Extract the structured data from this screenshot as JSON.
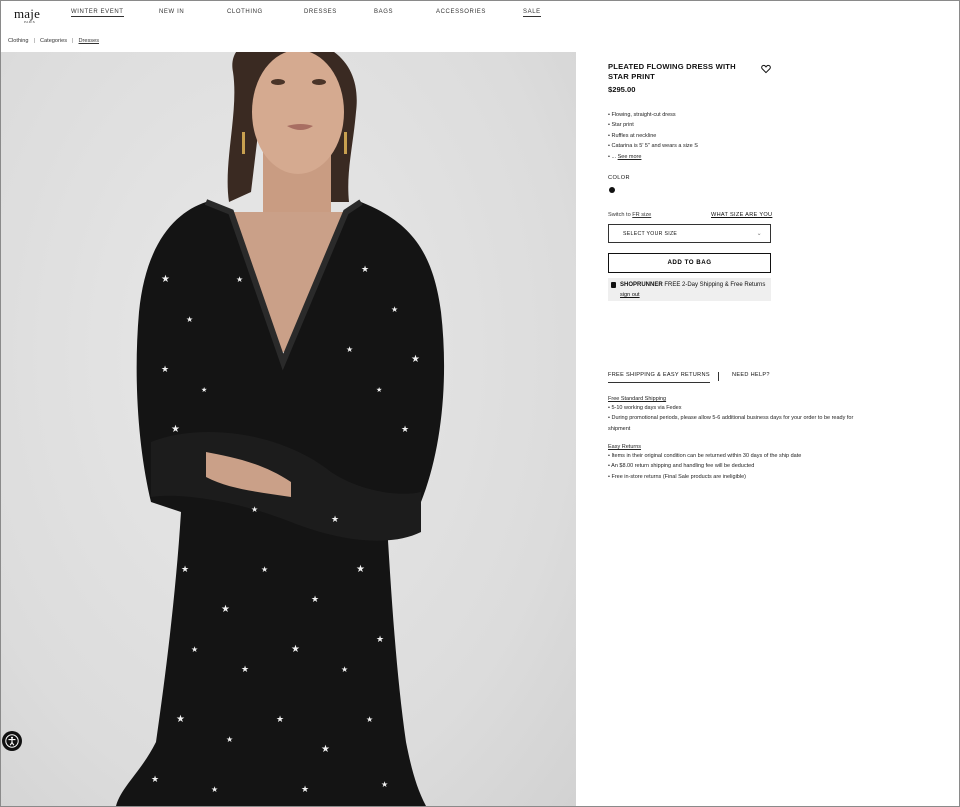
{
  "brand": {
    "logo": "maje",
    "logo_sub": "PARIS"
  },
  "nav": [
    {
      "label": "WINTER EVENT"
    },
    {
      "label": "NEW IN"
    },
    {
      "label": "CLOTHING"
    },
    {
      "label": "DRESSES"
    },
    {
      "label": "BAGS"
    },
    {
      "label": "ACCESSORIES"
    },
    {
      "label": "SALE"
    }
  ],
  "breadcrumb": {
    "items": [
      "Clothing",
      "Categories",
      "Dresses"
    ],
    "separator": "|"
  },
  "product": {
    "name": "PLEATED FLOWING DRESS WITH STAR PRINT",
    "price": "$295.00",
    "features": [
      "Flowing, straight-cut dress",
      "Star print",
      "Ruffles at neckline",
      "Catarina is 5' 5\" and wears a size S"
    ],
    "ellipsis": "...",
    "see_more": "See more",
    "color_label": "COLOR",
    "swatch_color": "#111111",
    "switch_prefix": "Switch to",
    "switch_link": "FR size",
    "size_guide": "WHAT SIZE ARE YOU",
    "size_placeholder": "SELECT YOUR SIZE",
    "add_to_bag": "ADD TO BAG",
    "shoprunner": {
      "brand": "SHOPRUNNER",
      "text": "FREE 2-Day Shipping & Free Returns",
      "signout": "sign out"
    }
  },
  "shipping": {
    "tabs": [
      "FREE SHIPPING & EASY RETURNS",
      "NEED HELP?"
    ],
    "standard_title": "Free Standard Shipping",
    "standard_items": [
      "5-10 working days via Fedex",
      "During promotional periods, please allow 5-6 additional business days for your order to be ready for shipment"
    ],
    "returns_title": "Easy Returns",
    "returns_items": [
      "Items in their original condition can be returned within 30 days of the ship date",
      "An $8.00 return shipping and handling fee will be deducted",
      "Free in-store returns (Final Sale products are ineligible)"
    ]
  },
  "icons": {
    "wishlist": "heart-icon",
    "accessibility": "accessibility-icon",
    "dropdown": "chevron-down-icon",
    "shoprunner": "shoprunner-icon"
  }
}
